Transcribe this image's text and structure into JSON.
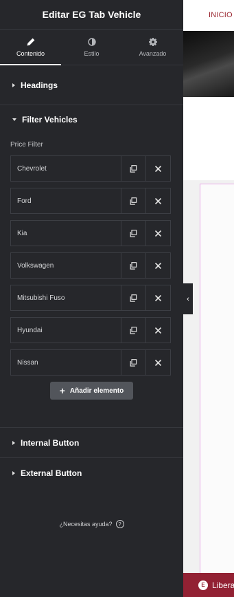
{
  "panel": {
    "title": "Editar EG Tab Vehicle",
    "tabs": [
      {
        "label": "Contenido",
        "icon": "pencil-icon",
        "active": true
      },
      {
        "label": "Estilo",
        "icon": "contrast-icon",
        "active": false
      },
      {
        "label": "Avanzado",
        "icon": "gear-icon",
        "active": false
      }
    ],
    "sections": {
      "headings": "Headings",
      "filter_vehicles": "Filter Vehicles",
      "internal_button": "Internal Button",
      "external_button": "External Button"
    },
    "price_filter_label": "Price Filter",
    "repeater_items": [
      "Chevrolet",
      "Ford",
      "Kia",
      "Volkswagen",
      "Mitsubishi Fuso",
      "Hyundai",
      "Nissan"
    ],
    "add_item_label": "Añadir elemento",
    "help_label": "¿Necesitas ayuda?",
    "help_icon": "?"
  },
  "preview": {
    "nav_item": "INICIO",
    "bottom_bar_text": "Libera",
    "bottom_bar_icon": "E",
    "collapse_icon": "‹"
  },
  "colors": {
    "panel_bg": "#26272b",
    "accent_dark_red": "#922133",
    "nav_red": "#9a2630",
    "content_outline": "#e6a8e6"
  }
}
